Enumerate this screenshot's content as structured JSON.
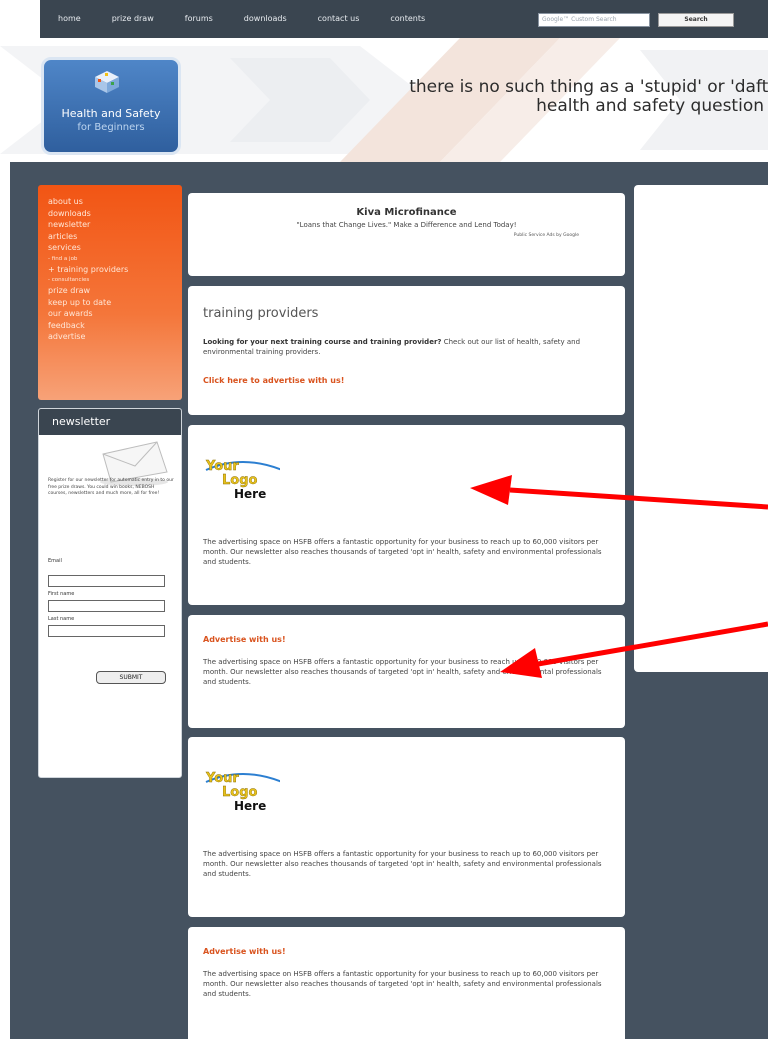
{
  "topnav": {
    "items": [
      "home",
      "prize draw",
      "forums",
      "downloads",
      "contact us",
      "contents"
    ],
    "search_placeholder": "Google™ Custom Search",
    "search_button": "Search"
  },
  "header": {
    "logo_line1": "Health and Safety",
    "logo_line2": "for Beginners",
    "tagline_line1": "there is no such thing as a 'stupid' or 'daft'",
    "tagline_line2": "health and safety question"
  },
  "sidebar": {
    "items": [
      {
        "label": "about us",
        "size": "normal"
      },
      {
        "label": "downloads",
        "size": "normal"
      },
      {
        "label": "newsletter",
        "size": "normal"
      },
      {
        "label": "articles",
        "size": "normal"
      },
      {
        "label": "services",
        "size": "normal"
      },
      {
        "label": "- find a job",
        "size": "small"
      },
      {
        "label": "+ training providers",
        "size": "normal"
      },
      {
        "label": "- consultancies",
        "size": "small"
      },
      {
        "label": "prize draw",
        "size": "normal"
      },
      {
        "label": "keep up to date",
        "size": "normal"
      },
      {
        "label": "our awards",
        "size": "normal"
      },
      {
        "label": "feedback",
        "size": "normal"
      },
      {
        "label": "advertise",
        "size": "normal"
      }
    ]
  },
  "newsletter": {
    "title": "newsletter",
    "text": "Register for our newsletter for automatic entry in to our free prize draws. You could win books, NEBOSH courses, newsletters and much more, all for free!",
    "email_label": "Email",
    "first_name_label": "First name",
    "last_name_label": "Last name",
    "submit": "SUBMIT"
  },
  "kiva": {
    "title": "Kiva Microfinance",
    "subtitle": "\"Loans that Change Lives.\" Make a Difference and Lend Today!",
    "attribution": "Public Service Ads by Google"
  },
  "training": {
    "heading": "training providers",
    "intro_bold": "Looking for your next training course and training provider?",
    "intro_rest": " Check out our list of health, safety and environmental training providers.",
    "link": "Click here to advertise with us!"
  },
  "ads": {
    "logo_your": "Your",
    "logo_logo": "Logo",
    "logo_here": "Here",
    "text": "The advertising space on HSFB offers a fantastic opportunity for your business to reach up to 60,000 visitors per month. Our newsletter also reaches thousands of targeted 'opt in' health, safety and environmental professionals and students.",
    "advertise_heading": "Advertise with us!"
  },
  "colors": {
    "nav_bg": "#3a4550",
    "page_bg": "#455260",
    "accent_orange": "#f25514",
    "annotation_arrow": "#ff0000"
  }
}
